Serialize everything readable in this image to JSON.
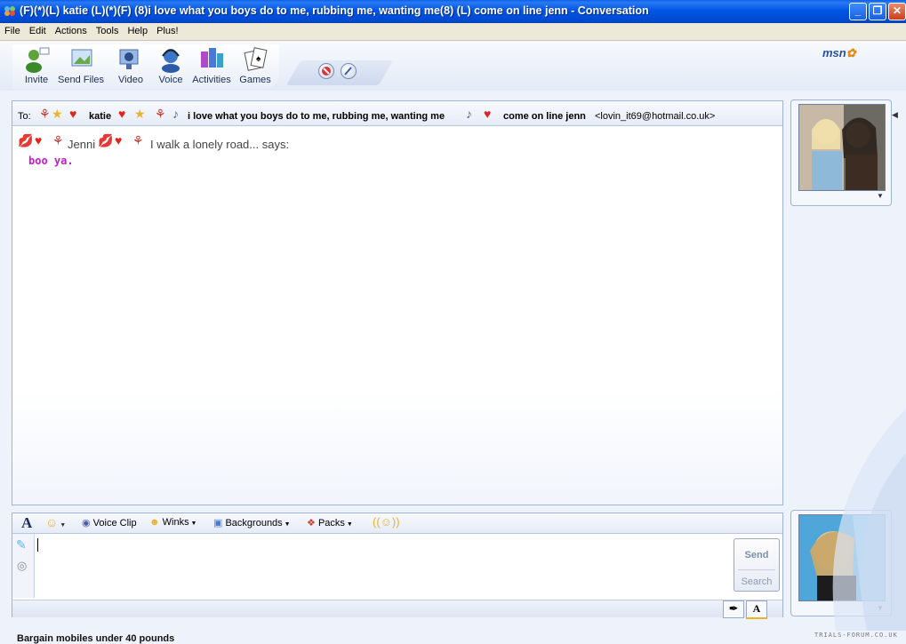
{
  "window": {
    "title": "(F)(*)(L) katie (L)(*)(F) (8)i love what you boys do to me, rubbing me, wanting me(8) (L) come on line jenn - Conversation"
  },
  "menu": [
    "File",
    "Edit",
    "Actions",
    "Tools",
    "Help",
    "Plus!"
  ],
  "toolbar": {
    "items": [
      {
        "label": "Invite",
        "icon": "invite-icon"
      },
      {
        "label": "Send Files",
        "icon": "send-files-icon"
      },
      {
        "label": "Video",
        "icon": "webcam-icon"
      },
      {
        "label": "Voice",
        "icon": "voice-headset-icon"
      },
      {
        "label": "Activities",
        "icon": "activities-icon"
      },
      {
        "label": "Games",
        "icon": "games-cards-icon"
      }
    ],
    "logo": "msn"
  },
  "to_bar": {
    "label": "To:",
    "contact_name": "katie",
    "personal_message": "i love what you boys do to me, rubbing me, wanting me",
    "personal_message_end": "come on line jenn",
    "email": "<lovin_it69@hotmail.co.uk>"
  },
  "history": {
    "sender_name": "Jenni",
    "sender_status": "I walk a lonely road... says:",
    "message": "boo ya."
  },
  "format_bar": {
    "font_label": "A",
    "voice_clip": "Voice Clip",
    "winks": "Winks",
    "backgrounds": "Backgrounds",
    "packs": "Packs"
  },
  "input": {
    "text": "",
    "send": "Send",
    "search": "Search"
  },
  "bottom_tabs": {
    "ink": "ink-tab",
    "text": "A"
  },
  "status": {
    "ad": "Bargain mobiles under 40 pounds",
    "watermark": "TRIALS-FORUM.CO.UK"
  },
  "colors": {
    "title_bar": "#0055e5",
    "message_text": "#c21bc7",
    "accent_heart": "#e0231c"
  }
}
